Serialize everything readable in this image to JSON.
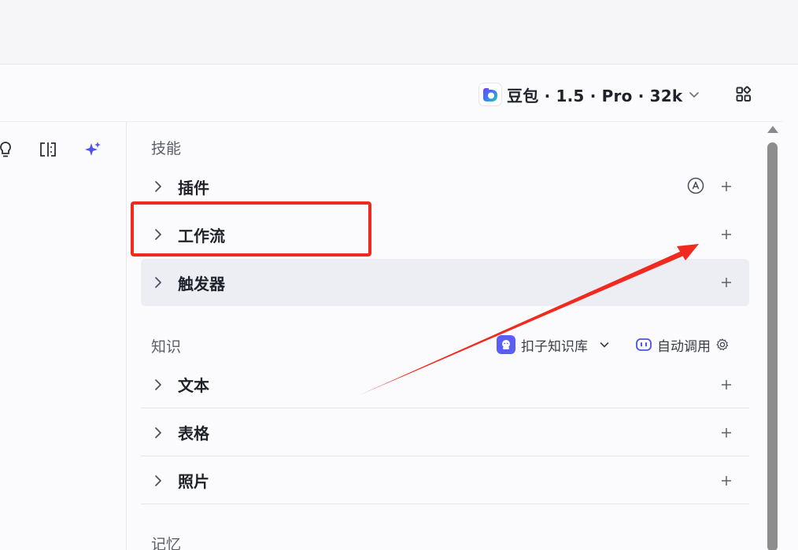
{
  "header": {
    "model_label": "豆包 · 1.5 · Pro · 32k",
    "model_icon": "doubao-logo-icon",
    "grid_icon": "grid-icon"
  },
  "left_toolbar": {
    "icons": [
      "lightbulb-icon",
      "split-view-icon",
      "sparkle-icon"
    ],
    "accent_color": "#4d53e8"
  },
  "skills": {
    "title": "技能",
    "items": [
      {
        "label": "插件"
      },
      {
        "label": "工作流"
      },
      {
        "label": "触发器"
      }
    ]
  },
  "knowledge": {
    "title": "知识",
    "source_label": "扣子知识库",
    "auto_call_label": "自动调用",
    "items": [
      {
        "label": "文本"
      },
      {
        "label": "表格"
      },
      {
        "label": "照片"
      }
    ]
  },
  "memory": {
    "title": "记忆"
  },
  "annotation": {
    "box_color": "#f02a1f",
    "arrow_color": "#f02a1f"
  }
}
